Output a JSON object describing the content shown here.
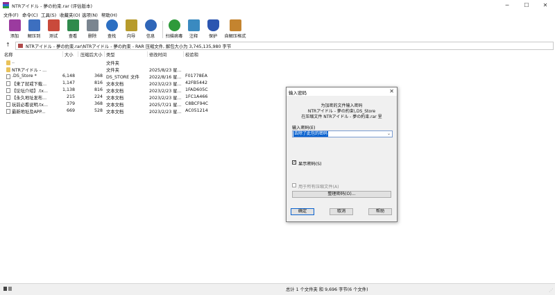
{
  "window": {
    "title": "NTRアイドル - 夢の約束.rar (评估版本)",
    "minimize_glyph": "─",
    "maximize_glyph": "☐",
    "close_glyph": "✕",
    "icon_colors": [
      "#8b2f8f",
      "#2a6bd1",
      "#2b9a3c"
    ]
  },
  "menu": [
    "文件(F)",
    "命令(C)",
    "工具(S)",
    "收藏夹(O)",
    "选项(N)",
    "帮助(H)"
  ],
  "toolbar": [
    {
      "label": "添加",
      "icon": "add-archive-icon",
      "color": "#9b3b9f"
    },
    {
      "label": "解压到",
      "icon": "extract-folder-icon",
      "color": "#3d6fbf"
    },
    {
      "label": "测试",
      "icon": "test-icon",
      "color": "#c94a3b"
    },
    {
      "label": "查看",
      "icon": "view-book-icon",
      "color": "#2f8a4c"
    },
    {
      "label": "删除",
      "icon": "trash-icon",
      "color": "#7a8590"
    },
    {
      "label": "查找",
      "icon": "magnifier-icon",
      "color": "#2c6fc2"
    },
    {
      "label": "向导",
      "icon": "wizard-wand-icon",
      "color": "#b79b2c"
    },
    {
      "label": "信息",
      "icon": "info-icon",
      "color": "#2f66b8"
    },
    {
      "label": "扫描病毒",
      "icon": "virus-scan-icon",
      "color": "#2e9a3a"
    },
    {
      "label": "注释",
      "icon": "comment-icon",
      "color": "#3a8ac0"
    },
    {
      "label": "保护",
      "icon": "shield-icon",
      "color": "#2b55b0"
    },
    {
      "label": "自解压格式",
      "icon": "sfx-icon",
      "color": "#c4842f"
    }
  ],
  "address": {
    "up_glyph": "↑",
    "path": "NTRアイドル - 夢の約束.rar\\NTRアイドル - 夢の約束 - RAR 压缩文件, 解包大小为 3,745,135,980 字节"
  },
  "columns": {
    "name": "名称",
    "size": "大小",
    "packed": "压缩后大小",
    "type": "类型",
    "modified": "修改时间",
    "crc": "校验和"
  },
  "files": [
    {
      "name": "..",
      "size": "",
      "packed": "",
      "type": "文件夹",
      "modified": "",
      "crc": "",
      "kind": "folder"
    },
    {
      "name": "NTRアイドル - ...",
      "size": "",
      "packed": "",
      "type": "文件夹",
      "modified": "2025/8/23 星...",
      "crc": "",
      "kind": "folder"
    },
    {
      "name": ".DS_Store *",
      "size": "6,148",
      "packed": "368",
      "type": "DS_STORE 文件",
      "modified": "2022/8/16 星...",
      "crc": "F01778EA",
      "kind": "file"
    },
    {
      "name": "【来了就戒下载...",
      "size": "1,147",
      "packed": "816",
      "type": "文本文档",
      "modified": "2023/2/23 星...",
      "crc": "42FB5442",
      "kind": "file"
    },
    {
      "name": "【论坛介绍】.tx...",
      "size": "1,138",
      "packed": "816",
      "type": "文本文档",
      "modified": "2023/2/23 星...",
      "crc": "1FAD605C",
      "kind": "file"
    },
    {
      "name": "【永久地址发布...",
      "size": "215",
      "packed": "224",
      "type": "文本文档",
      "modified": "2023/2/23 星...",
      "crc": "1FC1A466",
      "kind": "file"
    },
    {
      "name": "玩前必看说明.tx...",
      "size": "379",
      "packed": "368",
      "type": "文本文档",
      "modified": "2025/7/21 星...",
      "crc": "C8BCF94C",
      "kind": "file"
    },
    {
      "name": "最新地址及APP...",
      "size": "669",
      "packed": "528",
      "type": "文本文档",
      "modified": "2023/2/23 星...",
      "crc": "AC051214",
      "kind": "file"
    }
  ],
  "status": {
    "summary": "总计 1 个文件夹 和 9,696 字节(6 个文件)",
    "grip_glyph": "⋰"
  },
  "dialog": {
    "title": "输入密码",
    "close_glyph": "✕",
    "line1": "为加密的文件输入密码",
    "line2": "NTRアイドル - 夢の約束\\.DS_Store",
    "line3": "在压缩文件 NTRアイドル - 夢の約束.rar 里",
    "password_label": "输入密码(E)",
    "password_value": "去除了此包的密码",
    "dropdown_glyph": "⌄",
    "show_password_label": "显示密码(S)",
    "show_password_checked": true,
    "check_glyph": "✓",
    "use_all_label": "用于所有压缩文件(A)",
    "organize_button": "整理密码(O)...",
    "ok": "确定",
    "cancel": "取消",
    "help": "帮助"
  }
}
